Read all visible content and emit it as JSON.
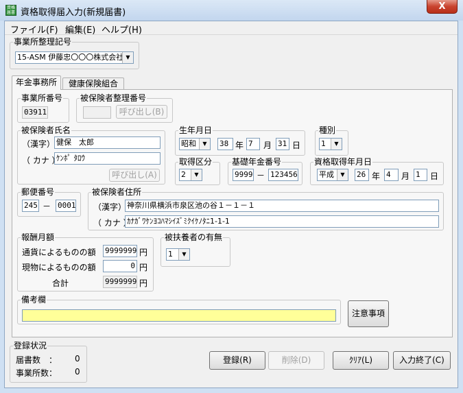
{
  "window": {
    "title": "資格取得届入力(新規届書)",
    "icon_text": "資格\n届書",
    "close_label": "X"
  },
  "menu": [
    "ファイル(F)",
    "編集(E)",
    "ヘルプ(H)"
  ],
  "office_code": {
    "label": "事業所整理記号",
    "value": "15-ASM  伊藤忠〇〇〇株式会社"
  },
  "tabs": [
    "年金事務所",
    "健康保険組合"
  ],
  "office_number": {
    "label": "事業所番号",
    "value": "03911"
  },
  "insured_number": {
    "label": "被保険者整理番号",
    "value": "",
    "call_button": "呼び出し(B)"
  },
  "name": {
    "label": "被保険者氏名",
    "kanji_label": "（漢字）",
    "kanji_value": "健保　太郎",
    "kana_label": "（ カナ ）",
    "kana_value": "ｹﾝﾎﾟ ﾀﾛｳ",
    "call_button": "呼び出し(A)"
  },
  "birthdate": {
    "label": "生年月日",
    "era": "昭和",
    "year": "38",
    "year_unit": "年",
    "month": "7",
    "month_unit": "月",
    "day": "31",
    "day_unit": "日"
  },
  "category": {
    "label": "種別",
    "value": "1"
  },
  "acquisition_type": {
    "label": "取得区分",
    "value": "2"
  },
  "pension_number": {
    "label": "基礎年金番号",
    "part1": "9999",
    "sep": "－",
    "part2": "123456"
  },
  "acquisition_date": {
    "label": "資格取得年月日",
    "era": "平成",
    "year": "26",
    "year_unit": "年",
    "month": "4",
    "month_unit": "月",
    "day": "1",
    "day_unit": "日"
  },
  "postal": {
    "label": "郵便番号",
    "part1": "245",
    "sep": "－",
    "part2": "0001"
  },
  "address": {
    "label": "被保険者住所",
    "kanji_label": "（漢字）",
    "kanji_value": "神奈川県横浜市泉区池の谷１－１－１",
    "kana_label": "（ カナ ）",
    "kana_value": "ｶﾅｶﾞﾜｹﾝﾖｺﾊﾏｼｲｽﾞﾐｸｲｹﾉﾀﾆ1-1-1"
  },
  "salary": {
    "label": "報酬月額",
    "currency_label": "通貨によるものの額",
    "currency_value": "9999999",
    "unit": "円",
    "inkind_label": "現物によるものの額",
    "inkind_value": "0",
    "total_label": "合計",
    "total_value": "9999999"
  },
  "dependents": {
    "label": "被扶養者の有無",
    "value": "1"
  },
  "remarks": {
    "label": "備考欄",
    "value": ""
  },
  "notice_button": "注意事項",
  "registration": {
    "label": "登録状況",
    "forms_label": "届書数　：",
    "forms_value": "0",
    "offices_label": "事業所数：",
    "offices_value": "0"
  },
  "buttons": {
    "register": "登録(R)",
    "delete": "削除(D)",
    "clear": "ｸﾘｱ(L)",
    "finish": "入力終了(C)"
  },
  "colors": {
    "remarks_bg": "#ffff99",
    "close_bg": "#c9432e"
  }
}
